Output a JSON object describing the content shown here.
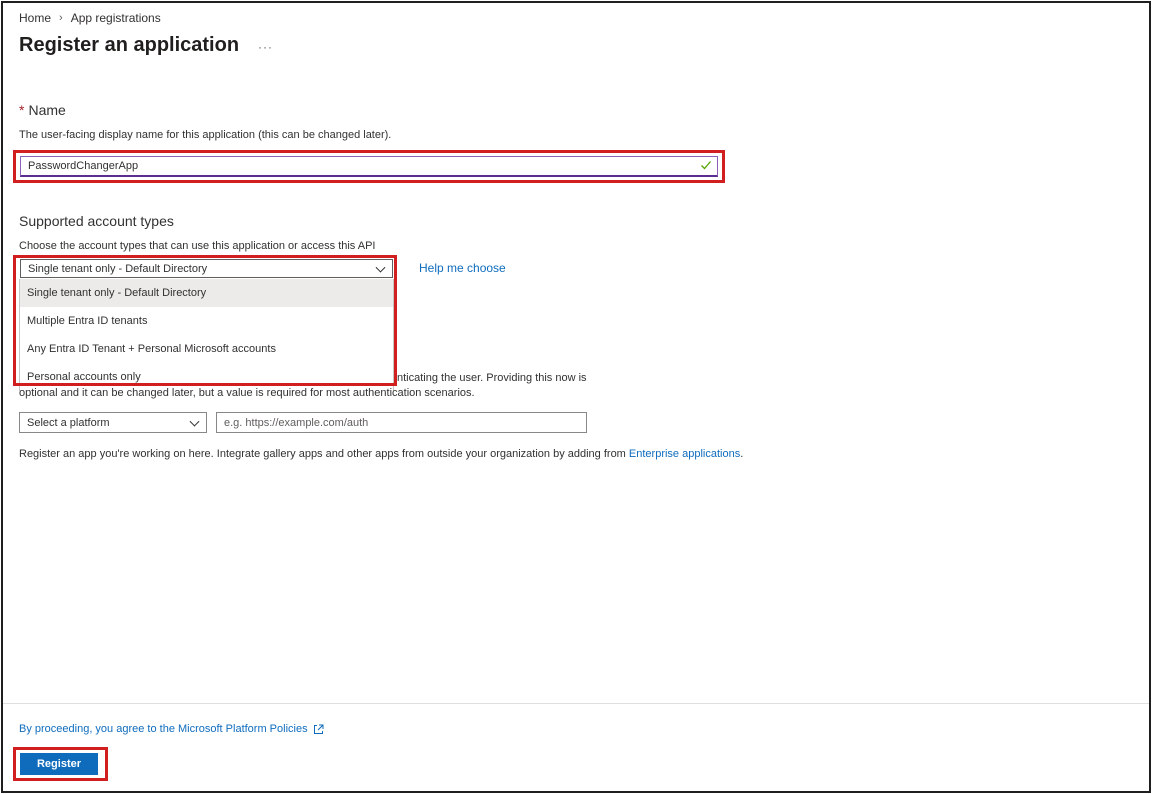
{
  "breadcrumb": {
    "home": "Home",
    "separator": "›",
    "current": "App registrations"
  },
  "page": {
    "title": "Register an application",
    "more_label": "···"
  },
  "name_section": {
    "required_mark": "*",
    "label": "Name",
    "description": "The user-facing display name for this application (this can be changed later).",
    "value": "PasswordChangerApp"
  },
  "account_section": {
    "label": "Supported account types",
    "description": "Choose the account types that can use this application or access this API",
    "selected": "Single tenant only - Default Directory",
    "help_link": "Help me choose",
    "options": [
      "Single tenant only - Default Directory",
      "Multiple Entra ID tenants",
      "Any Entra ID Tenant + Personal Microsoft accounts",
      "Personal accounts only"
    ]
  },
  "redirect_section": {
    "line1_visible": "nticating the user. Providing this now is",
    "line2_visible": "optional and it can be changed later, but a value is required for most authentication scenarios.",
    "platform_placeholder": "Select a platform",
    "url_placeholder": "e.g. https://example.com/auth"
  },
  "enterprise": {
    "text": "Register an app you're working on here. Integrate gallery apps and other apps from outside your organization by adding from ",
    "link": "Enterprise applications",
    "suffix": "."
  },
  "footer": {
    "policy_link": "By proceeding, you agree to the Microsoft Platform Policies",
    "register_label": "Register"
  },
  "colors": {
    "accent": "#0f6cbd",
    "highlight": "#d11f1f",
    "required": "#a4262c",
    "valid": "#57a300"
  },
  "icons": {
    "valid": "check-icon",
    "dropdown": "chevron-down-icon",
    "external": "external-link-icon"
  }
}
